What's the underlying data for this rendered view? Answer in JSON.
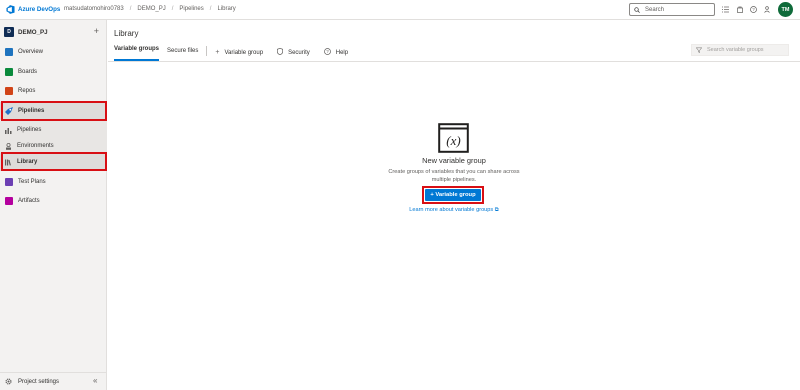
{
  "topbar": {
    "brand": "Azure DevOps",
    "breadcrumbs": [
      "matsudatomohiro0783",
      "DEMO_PJ",
      "Pipelines",
      "Library"
    ],
    "separator": "/",
    "search_placeholder": "Search",
    "avatar_initials": "TM",
    "icons": [
      "list-icon",
      "shopping-bag-icon",
      "help-icon",
      "person-settings-icon"
    ]
  },
  "sidebar": {
    "project_badge": "D",
    "project_name": "DEMO_PJ",
    "add_symbol": "+",
    "items": [
      {
        "label": "Overview",
        "color": "#1e73be"
      },
      {
        "label": "Boards",
        "color": "#0a8a3c"
      },
      {
        "label": "Repos",
        "color": "#d14418"
      },
      {
        "label": "Pipelines",
        "color": "#1f6fc9"
      },
      {
        "label": "Pipelines",
        "color": "#605e5c"
      },
      {
        "label": "Environments",
        "color": "#605e5c"
      },
      {
        "label": "Library",
        "color": "#605e5c"
      },
      {
        "label": "Test Plans",
        "color": "#6c3fb3"
      },
      {
        "label": "Artifacts",
        "color": "#b4009e"
      }
    ],
    "footer_label": "Project settings",
    "collapse_symbol": "«"
  },
  "main": {
    "page_title": "Library",
    "tabs": [
      "Variable groups",
      "Secure files"
    ],
    "actions": [
      {
        "symbol": "+",
        "label": "Variable group"
      },
      {
        "symbol": "⛉",
        "label": "Security"
      },
      {
        "symbol": "?",
        "label": "Help"
      }
    ],
    "filter_placeholder": "Search variable groups",
    "empty": {
      "icon_text": "(x)",
      "title": "New variable group",
      "description": "Create groups of variables that you can share across multiple pipelines.",
      "button_label": "+ Variable group",
      "link_label": "Learn more about variable groups ⧉"
    }
  },
  "colors": {
    "accent": "#0078d4",
    "highlight": "#d80f14"
  }
}
